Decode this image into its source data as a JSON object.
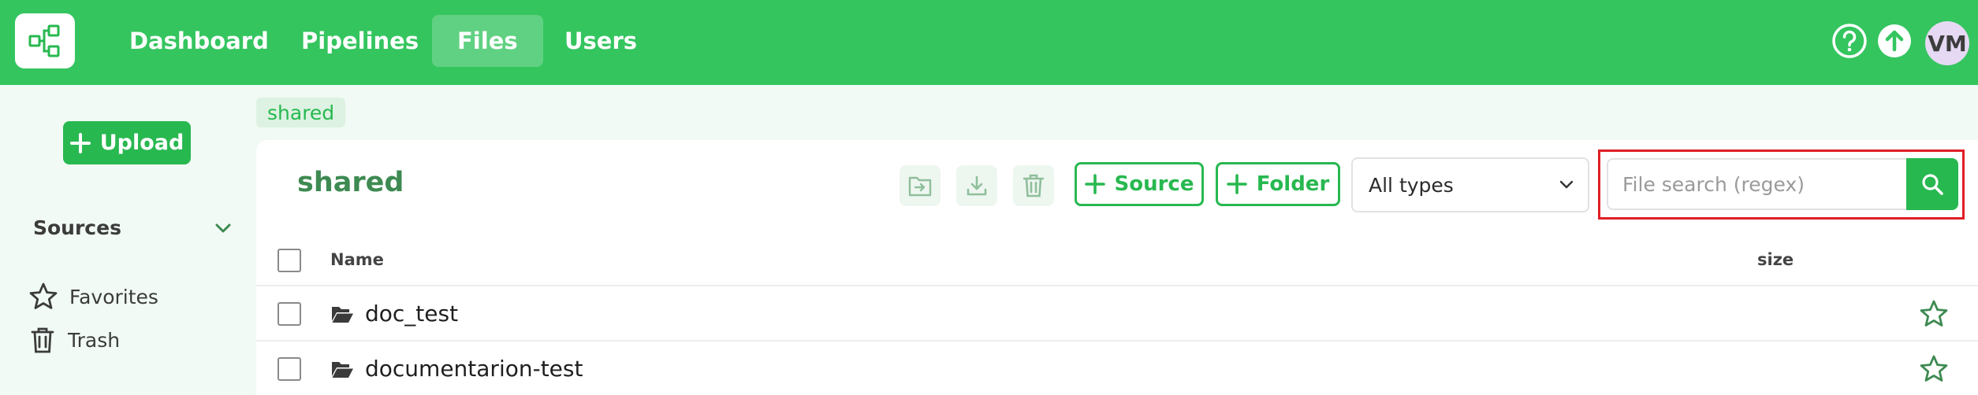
{
  "topbar": {
    "nav": [
      {
        "label": "Dashboard",
        "active": false
      },
      {
        "label": "Pipelines",
        "active": false
      },
      {
        "label": "Files",
        "active": true
      },
      {
        "label": "Users",
        "active": false
      }
    ],
    "avatar_initials": "VM",
    "icons": [
      "help-icon",
      "upload-arrow-icon"
    ]
  },
  "sidebar": {
    "upload_label": "Upload",
    "sources_label": "Sources",
    "links": [
      {
        "label": "Favorites",
        "icon": "star-icon"
      },
      {
        "label": "Trash",
        "icon": "trash-icon"
      }
    ]
  },
  "breadcrumb": {
    "label": "shared"
  },
  "panel": {
    "title": "shared",
    "toolbar": {
      "move_icon": "move-to-folder-icon",
      "download_icon": "download-icon",
      "delete_icon": "trash-icon",
      "source_label": "Source",
      "folder_label": "Folder",
      "type_filter": "All types",
      "search_placeholder": "File search (regex)"
    },
    "table": {
      "columns": [
        "Name",
        "size"
      ],
      "rows": [
        {
          "name": "doc_test",
          "type": "folder"
        },
        {
          "name": "documentarion-test",
          "type": "folder"
        }
      ]
    }
  },
  "colors": {
    "brand_green": "#34c55f",
    "button_green": "#28b850",
    "title_green": "#3e8a52",
    "highlight_red": "#e01f26"
  }
}
